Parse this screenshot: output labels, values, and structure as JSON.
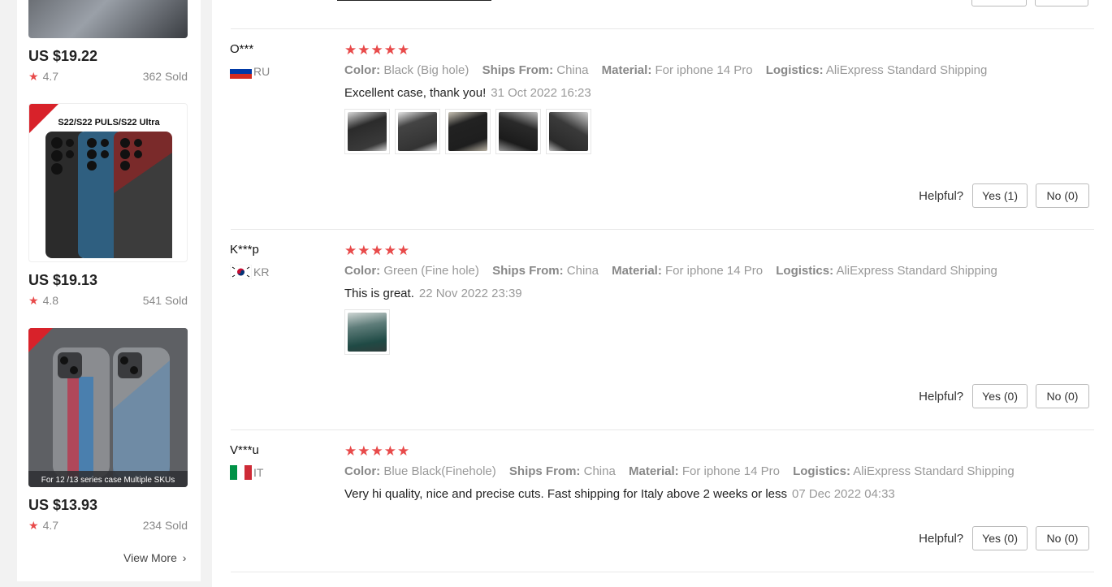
{
  "sidebar": {
    "products": [
      {
        "price": "US $19.22",
        "rating": "4.7",
        "sold": "362 Sold"
      },
      {
        "price": "US $19.13",
        "rating": "4.8",
        "sold": "541 Sold",
        "image_caption": "S22/S22 PULS/S22 Ultra"
      },
      {
        "price": "US $13.93",
        "rating": "4.7",
        "sold": "234 Sold",
        "image_caption": "For 12 /13 series case Multiple SKUs"
      }
    ],
    "view_more": "View More"
  },
  "reviews": [
    {
      "user": "O***",
      "country": "RU",
      "stars": "★★★★★",
      "color_label": "Color:",
      "color": "Black (Big hole)",
      "ships_label": "Ships From:",
      "ships": "China",
      "material_label": "Material:",
      "material": "For iphone 14 Pro",
      "logistics_label": "Logistics:",
      "logistics": "AliExpress Standard Shipping",
      "text": "Excellent case, thank you!",
      "date": "31 Oct 2022 16:23",
      "helpful_label": "Helpful?",
      "yes": "Yes (1)",
      "no": "No (0)"
    },
    {
      "user": "K***p",
      "country": "KR",
      "stars": "★★★★★",
      "color_label": "Color:",
      "color": "Green (Fine hole)",
      "ships_label": "Ships From:",
      "ships": "China",
      "material_label": "Material:",
      "material": "For iphone 14 Pro",
      "logistics_label": "Logistics:",
      "logistics": "AliExpress Standard Shipping",
      "text": "This is great.",
      "date": "22 Nov 2022 23:39",
      "helpful_label": "Helpful?",
      "yes": "Yes (0)",
      "no": "No (0)"
    },
    {
      "user": "V***u",
      "country": "IT",
      "stars": "★★★★★",
      "color_label": "Color:",
      "color": "Blue Black(Finehole)",
      "ships_label": "Ships From:",
      "ships": "China",
      "material_label": "Material:",
      "material": "For iphone 14 Pro",
      "logistics_label": "Logistics:",
      "logistics": "AliExpress Standard Shipping",
      "text": "Very hi quality, nice and precise cuts. Fast shipping for Italy above 2 weeks or less",
      "date": "07 Dec 2022 04:33",
      "helpful_label": "Helpful?",
      "yes": "Yes (0)",
      "no": "No (0)"
    }
  ],
  "colors": {
    "star": "#e84a4a",
    "muted": "#999999"
  }
}
